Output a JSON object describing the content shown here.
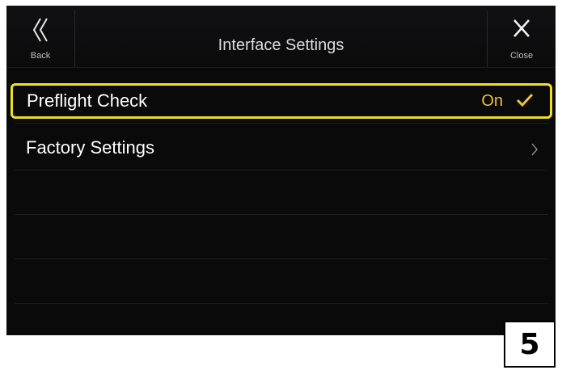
{
  "header": {
    "title": "Interface Settings",
    "back_label": "Back",
    "close_label": "Close"
  },
  "settings": [
    {
      "label": "Preflight Check",
      "value": "On",
      "selected": true
    },
    {
      "label": "Factory Settings"
    }
  ],
  "step_badge": "5",
  "colors": {
    "highlight": "#f1df1f",
    "value_text": "#f2c233",
    "background": "#0a0a0b"
  },
  "icons": {
    "back": "double-chevron-left-icon",
    "close": "close-x-icon",
    "checked": "checkmark-icon",
    "next": "chevron-right-icon"
  }
}
